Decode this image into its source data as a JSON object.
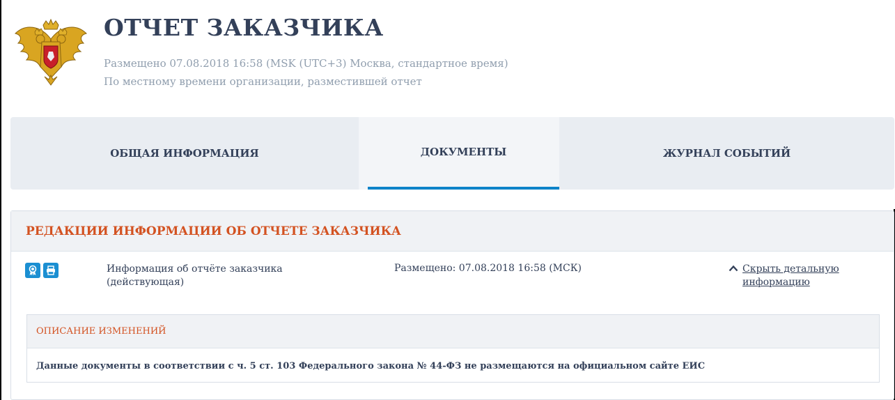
{
  "header": {
    "title": "ОТЧЕТ ЗАКАЗЧИКА",
    "posted": "Размещено 07.08.2018 16:58 (MSK (UTC+3) Москва, стандартное время)",
    "local_note": "По местному времени организации, разместившей отчет",
    "emblem_icon": "russian-coat-of-arms-icon"
  },
  "tabs": [
    {
      "label": "ОБЩАЯ ИНФОРМАЦИЯ",
      "active": false
    },
    {
      "label": "ДОКУМЕНТЫ",
      "active": true
    },
    {
      "label": "ЖУРНАЛ СОБЫТИЙ",
      "active": false
    }
  ],
  "section": {
    "title": "РЕДАКЦИИ ИНФОРМАЦИИ ОБ ОТЧЕТЕ ЗАКАЗЧИКА",
    "document": {
      "name": "Информация об отчёте заказчика (действующая)",
      "posted": "Размещено: 07.08.2018 16:58 (МСК)",
      "hide_link": "Скрыть детальную информацию",
      "icons": [
        "certificate-icon",
        "print-icon"
      ]
    },
    "changes": {
      "title": "ОПИСАНИЕ ИЗМЕНЕНИЙ",
      "text": "Данные документы в соответствии с ч. 5 ст. 103 Федерального закона № 44-ФЗ не размещаются на официальном сайте ЕИС"
    }
  },
  "colors": {
    "accent_orange": "#d35221",
    "accent_blue": "#1b8fd2",
    "text": "#334059",
    "muted": "#909eae"
  }
}
